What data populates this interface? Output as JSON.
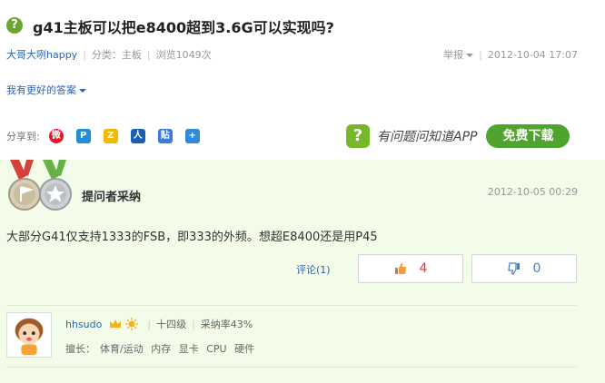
{
  "question": {
    "icon_glyph": "?",
    "title": "g41主板可以把e8400超到3.6G可以实现吗?"
  },
  "meta": {
    "user": "大哥大咧happy",
    "category_label": "分类：主板",
    "views": "浏览1049次",
    "report": "举报",
    "date": "2012-10-04 17:07"
  },
  "better_answer": "我有更好的答案",
  "share": {
    "label": "分享到:",
    "icons": [
      "weibo-icon",
      "qzone-icon",
      "tqq-icon",
      "renren-icon",
      "tieba-icon",
      "more-share-icon"
    ]
  },
  "app_promo": {
    "text": "有问题问知道APP",
    "button": "免费下载"
  },
  "answer": {
    "badge": "提问者采纳",
    "date": "2012-10-05 00:29",
    "content": "大部分G41仅支持1333的FSB，即333的外频。想超E8400还是用P45",
    "comment_label": "评论(1)",
    "upvotes": "4",
    "downvotes": "0"
  },
  "answerer": {
    "name": "hhsudo",
    "level": "十四级",
    "adoption_rate": "采纳率43%",
    "skills_label": "擅长：",
    "skills": [
      "体育/运动",
      "内存",
      "显卡",
      "CPU",
      "硬件"
    ]
  },
  "colors": {
    "accent_green": "#4ea42d",
    "link_blue": "#2d64b3",
    "answer_bg": "#f3fbe9"
  }
}
